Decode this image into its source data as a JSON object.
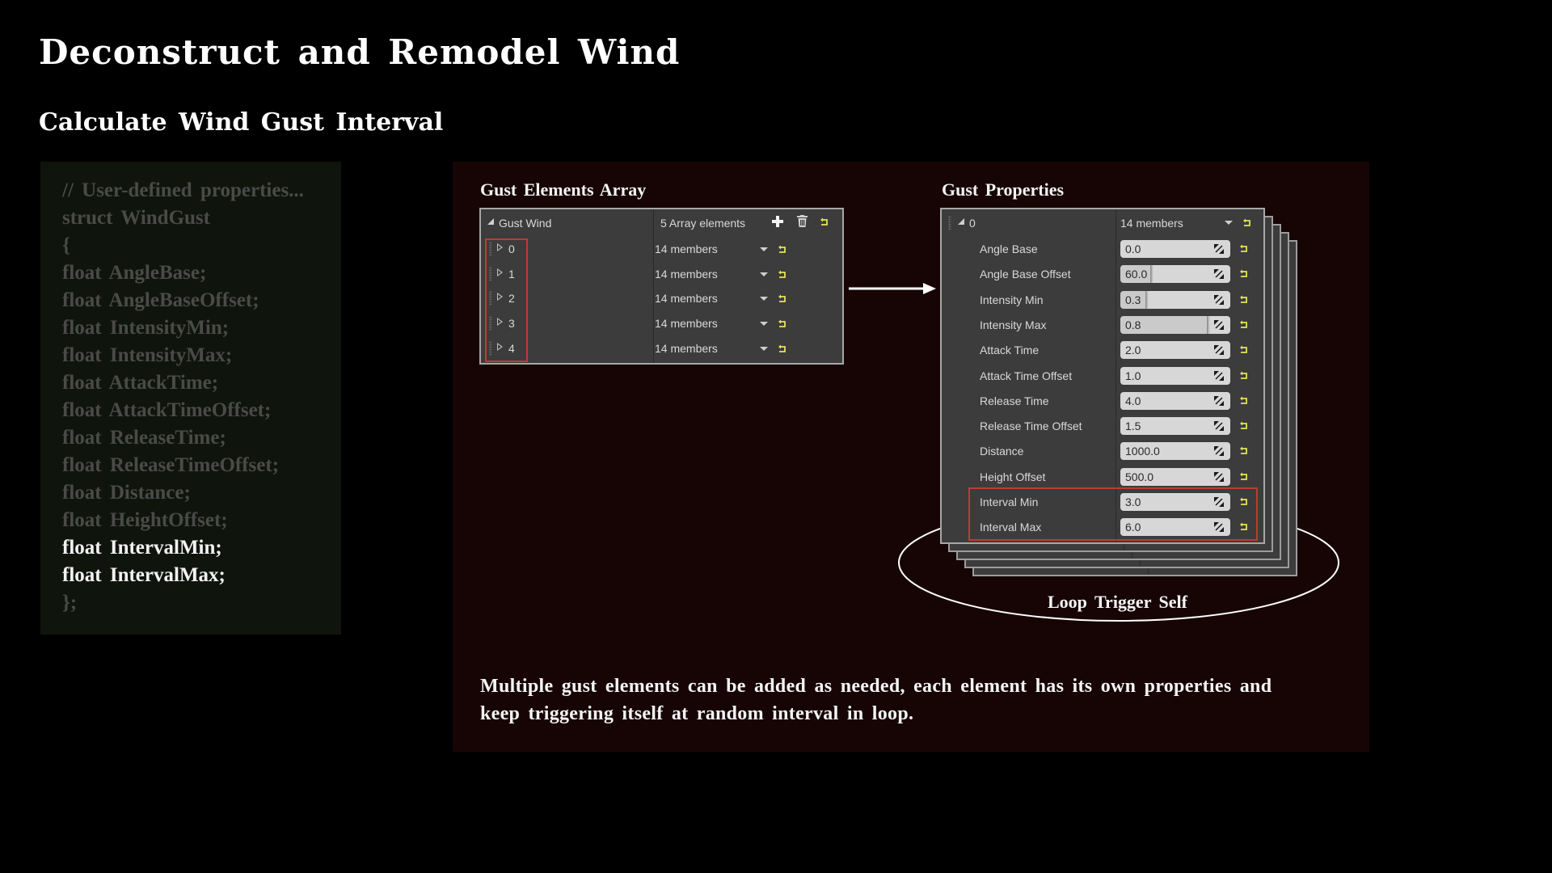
{
  "header": {
    "title": "Deconstruct and Remodel Wind",
    "subtitle": "Calculate Wind Gust Interval"
  },
  "code": {
    "lines": [
      {
        "text": "// User-defined properties...",
        "highlight": false
      },
      {
        "text": "struct WindGust",
        "highlight": false
      },
      {
        "text": "{",
        "highlight": false
      },
      {
        "text": "float AngleBase;",
        "highlight": false
      },
      {
        "text": "float AngleBaseOffset;",
        "highlight": false
      },
      {
        "text": "float IntensityMin;",
        "highlight": false
      },
      {
        "text": "float IntensityMax;",
        "highlight": false
      },
      {
        "text": "float AttackTime;",
        "highlight": false
      },
      {
        "text": "float AttackTimeOffset;",
        "highlight": false
      },
      {
        "text": "float ReleaseTime;",
        "highlight": false
      },
      {
        "text": "float ReleaseTimeOffset;",
        "highlight": false
      },
      {
        "text": "float Distance;",
        "highlight": false
      },
      {
        "text": "float HeightOffset;",
        "highlight": false
      },
      {
        "text": "float IntervalMin;",
        "highlight": true
      },
      {
        "text": "float IntervalMax;",
        "highlight": true
      },
      {
        "text": "};",
        "highlight": false
      }
    ]
  },
  "gust_elements": {
    "section_label": "Gust Elements Array",
    "header_label": "Gust Wind",
    "count_label": "5 Array elements",
    "add_icon": "plus-icon",
    "delete_icon": "trash-icon",
    "reset_icon": "reset-arrow-icon",
    "elements": [
      {
        "index": "0",
        "value": "14 members"
      },
      {
        "index": "1",
        "value": "14 members"
      },
      {
        "index": "2",
        "value": "14 members"
      },
      {
        "index": "3",
        "value": "14 members"
      },
      {
        "index": "4",
        "value": "14 members"
      }
    ]
  },
  "gust_properties": {
    "section_label": "Gust Properties",
    "element_index": "0",
    "element_value": "14 members",
    "properties": [
      {
        "label": "Angle Base",
        "value": "0.0",
        "slider_fraction": 0
      },
      {
        "label": "Angle Base Offset",
        "value": "60.0",
        "slider_fraction": 0.27
      },
      {
        "label": "Intensity Min",
        "value": "0.3",
        "slider_fraction": 0.23
      },
      {
        "label": "Intensity Max",
        "value": "0.8",
        "slider_fraction": 0.79
      },
      {
        "label": "Attack Time",
        "value": "2.0",
        "slider_fraction": 0
      },
      {
        "label": "Attack Time Offset",
        "value": "1.0",
        "slider_fraction": 0
      },
      {
        "label": "Release Time",
        "value": "4.0",
        "slider_fraction": 0
      },
      {
        "label": "Release Time Offset",
        "value": "1.5",
        "slider_fraction": 0
      },
      {
        "label": "Distance",
        "value": "1000.0",
        "slider_fraction": 0
      },
      {
        "label": "Height Offset",
        "value": "500.0",
        "slider_fraction": 0
      },
      {
        "label": "Interval Min",
        "value": "3.0",
        "slider_fraction": 0
      },
      {
        "label": "Interval Max",
        "value": "6.0",
        "slider_fraction": 0
      }
    ],
    "stack_count": 4
  },
  "loop_label": "Loop Trigger Self",
  "description": "Multiple gust elements can be added as needed, each element has its own properties and keep triggering itself at random interval in loop.",
  "colors": {
    "highlight_red": "#c23a30",
    "reset_yellow": "#e3e35a",
    "main_panel_bg": "#170505",
    "code_panel_bg": "#0f150d"
  }
}
